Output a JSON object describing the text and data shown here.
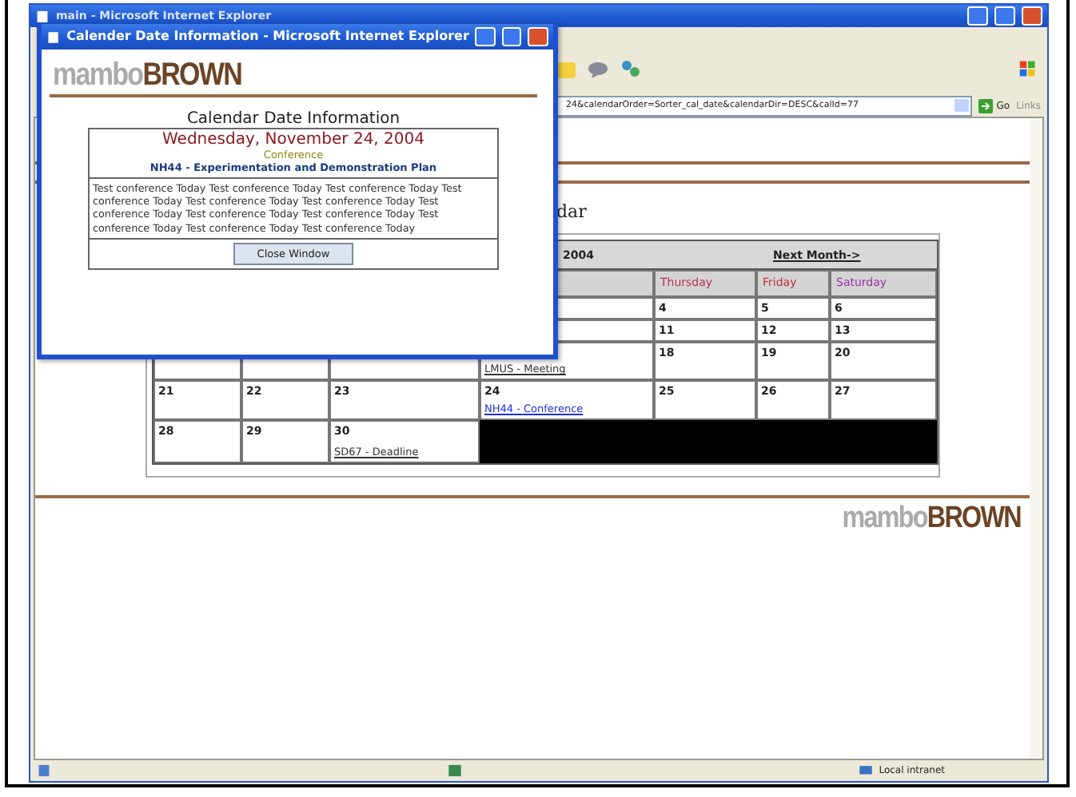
{
  "main_window": {
    "title": "main - Microsoft Internet Explorer",
    "address": "24&calendarOrder=Sorter_cal_date&calendarDir=DESC&calId=77",
    "go_label": "Go",
    "links_label": "Links",
    "heading": "dar",
    "logo": {
      "light": "mambo",
      "dark": "BROWN"
    },
    "status_zone": "Local intranet"
  },
  "calendar": {
    "month_label": "2004",
    "next_link": "Next Month->",
    "day_headers": [
      {
        "label": "Thursday",
        "color": "#b83050"
      },
      {
        "label": "Friday",
        "color": "#c03040"
      },
      {
        "label": "Saturday",
        "color": "#9a30a8"
      }
    ],
    "weeks": [
      {
        "cells": [
          null,
          null,
          null,
          null,
          {
            "day": "4"
          },
          {
            "day": "5"
          },
          {
            "day": "6"
          }
        ]
      },
      {
        "cells": [
          null,
          null,
          null,
          null,
          {
            "day": "11"
          },
          {
            "day": "12"
          },
          {
            "day": "13"
          }
        ]
      },
      {
        "cells": [
          null,
          null,
          null,
          {
            "event": {
              "label": "LMUS - Meeting",
              "visited": true
            }
          },
          {
            "day": "18"
          },
          {
            "day": "19"
          },
          {
            "day": "20"
          }
        ]
      },
      {
        "cells": [
          {
            "day": "21"
          },
          {
            "day": "22"
          },
          {
            "day": "23"
          },
          {
            "day": "24",
            "event": {
              "label": "NH44 - Conference",
              "visited": false
            }
          },
          {
            "day": "25"
          },
          {
            "day": "26"
          },
          {
            "day": "27"
          }
        ]
      },
      {
        "cells": [
          {
            "day": "28"
          },
          {
            "day": "29"
          },
          {
            "day": "30",
            "event": {
              "label": "SD67 - Deadline",
              "visited": true
            }
          }
        ],
        "trailing_blank": true
      }
    ]
  },
  "popup": {
    "title": "Calender Date Information - Microsoft Internet Explorer",
    "logo": {
      "light": "mambo",
      "dark": "BROWN"
    },
    "heading": "Calendar Date Information",
    "date": "Wednesday, November 24, 2004",
    "category": "Conference",
    "event_title": "NH44 - Experimentation and Demonstration Plan",
    "description": "Test conference Today Test conference Today Test conference Today Test conference Today Test conference Today Test conference Today Test conference Today Test conference Today Test conference Today Test conference Today Test conference Today Test conference Today",
    "close_button": "Close Window"
  }
}
